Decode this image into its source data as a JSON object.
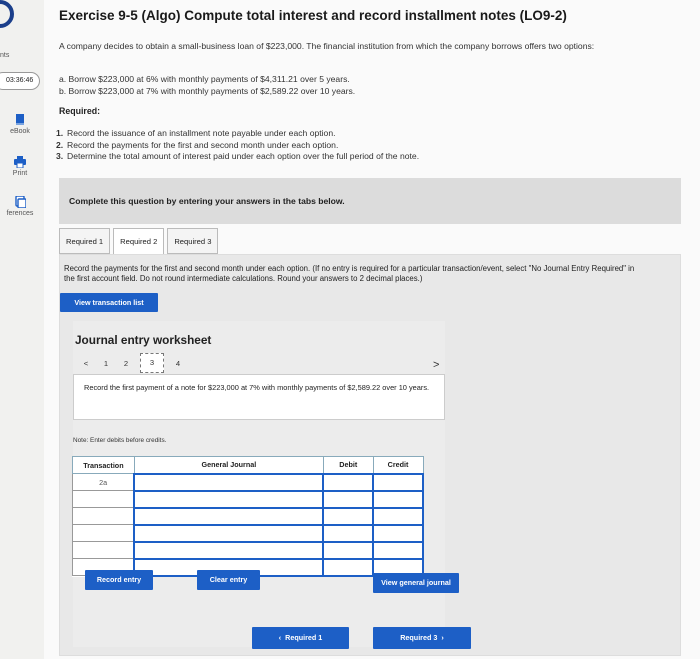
{
  "sidebar": {
    "points_label": "nts",
    "timer": "03:36:46",
    "ebook_label": "eBook",
    "print_label": "Print",
    "references_label": "ferences"
  },
  "header": {
    "title": "Exercise 9-5 (Algo) Compute total interest and record installment notes (LO9-2)"
  },
  "problem": {
    "intro": "A company decides to obtain a small-business loan of $223,000. The financial institution from which the company borrows offers two options:",
    "option_a": "a. Borrow $223,000 at 6% with monthly payments of $4,311.21 over 5 years.",
    "option_b": "b. Borrow $223,000 at 7% with monthly payments of $2,589.22 over 10 years.",
    "required_heading": "Required:",
    "required": [
      {
        "num": "1.",
        "text": "Record the issuance of an installment note payable under each option."
      },
      {
        "num": "2.",
        "text": "Record the payments for the first and second month under each option."
      },
      {
        "num": "3.",
        "text": "Determine the total amount of interest paid under each option over the full period of the note."
      }
    ]
  },
  "complete_banner": "Complete this question by entering your answers in the tabs below.",
  "tabs": [
    {
      "label": "Required 1"
    },
    {
      "label": "Required 2"
    },
    {
      "label": "Required 3"
    }
  ],
  "panel": {
    "instruction": "Record the payments for the first and second month under each option. (If no entry is required for a particular transaction/event, select \"No Journal Entry Required\" in the first account field. Do not round intermediate calculations. Round your answers to 2 decimal places.)",
    "view_transaction_list": "View transaction list"
  },
  "worksheet": {
    "title": "Journal entry worksheet",
    "pages": [
      "1",
      "2",
      "3",
      "4"
    ],
    "current_page": "3",
    "prev_arrow": "<",
    "next_arrow": ">",
    "description": "Record the first payment of a note for $223,000 at 7% with monthly payments of $2,589.22 over 10 years.",
    "note": "Note: Enter debits before credits.",
    "columns": {
      "transaction": "Transaction",
      "account": "General Journal",
      "debit": "Debit",
      "credit": "Credit"
    },
    "transaction_id": "2a",
    "record_entry": "Record entry",
    "clear_entry": "Clear entry",
    "view_general_journal": "View general journal"
  },
  "navigation": {
    "prev_label": "Required 1",
    "next_label": "Required 3"
  },
  "colors": {
    "accent": "#1d5fc6",
    "banner": "#dcdcdc"
  }
}
